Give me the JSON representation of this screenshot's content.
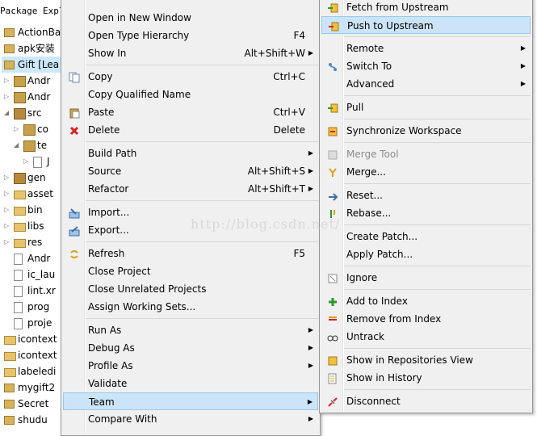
{
  "explorer": {
    "title": "Package Expl",
    "items": [
      {
        "label": "ActionBa",
        "indent": 0,
        "icon": "project-icon",
        "twisty": ""
      },
      {
        "label": "apk安装",
        "indent": 0,
        "icon": "project-icon",
        "twisty": ""
      },
      {
        "label": "Gift [Lea",
        "indent": 0,
        "icon": "project-icon",
        "twisty": "",
        "selected": true
      },
      {
        "label": "Andr",
        "indent": 1,
        "icon": "library-icon",
        "twisty": "▷"
      },
      {
        "label": "Andr",
        "indent": 1,
        "icon": "library-icon",
        "twisty": "▷"
      },
      {
        "label": "src",
        "indent": 1,
        "icon": "source-folder-icon",
        "twisty": "◢"
      },
      {
        "label": "co",
        "indent": 2,
        "icon": "package-icon",
        "twisty": "▷"
      },
      {
        "label": "te",
        "indent": 2,
        "icon": "package-icon",
        "twisty": "◢"
      },
      {
        "label": "J",
        "indent": 3,
        "icon": "java-file-icon",
        "twisty": "▷"
      },
      {
        "label": "gen",
        "indent": 1,
        "icon": "source-folder-icon",
        "twisty": "▷"
      },
      {
        "label": "asset",
        "indent": 1,
        "icon": "folder-icon",
        "twisty": "▷"
      },
      {
        "label": "bin",
        "indent": 1,
        "icon": "folder-icon",
        "twisty": "▷"
      },
      {
        "label": "libs",
        "indent": 1,
        "icon": "folder-icon",
        "twisty": "▷"
      },
      {
        "label": "res",
        "indent": 1,
        "icon": "folder-icon",
        "twisty": "▷"
      },
      {
        "label": "Andr",
        "indent": 1,
        "icon": "file-icon",
        "twisty": ""
      },
      {
        "label": "ic_lau",
        "indent": 1,
        "icon": "file-icon",
        "twisty": ""
      },
      {
        "label": "lint.xr",
        "indent": 1,
        "icon": "file-icon",
        "twisty": ""
      },
      {
        "label": "prog",
        "indent": 1,
        "icon": "file-icon",
        "twisty": ""
      },
      {
        "label": "proje",
        "indent": 1,
        "icon": "file-icon",
        "twisty": ""
      },
      {
        "label": "icontext",
        "indent": 0,
        "icon": "closed-project-icon",
        "twisty": ""
      },
      {
        "label": "icontext",
        "indent": 0,
        "icon": "closed-project-icon",
        "twisty": ""
      },
      {
        "label": "labeledi",
        "indent": 0,
        "icon": "closed-project-icon",
        "twisty": ""
      },
      {
        "label": "mygift2",
        "indent": 0,
        "icon": "project-icon",
        "twisty": ""
      },
      {
        "label": "Secret",
        "indent": 0,
        "icon": "project-icon",
        "twisty": ""
      },
      {
        "label": "shudu",
        "indent": 0,
        "icon": "project-icon",
        "twisty": ""
      }
    ]
  },
  "context_menu": {
    "items": [
      {
        "label": "Open in New Window",
        "shortcut": "",
        "arrow": false,
        "icon": ""
      },
      {
        "label": "Open Type Hierarchy",
        "shortcut": "F4",
        "arrow": false,
        "icon": ""
      },
      {
        "label": "Show In",
        "shortcut": "Alt+Shift+W",
        "arrow": true,
        "icon": ""
      },
      {
        "sep": true
      },
      {
        "label": "Copy",
        "shortcut": "Ctrl+C",
        "arrow": false,
        "icon": "copy-icon"
      },
      {
        "label": "Copy Qualified Name",
        "shortcut": "",
        "arrow": false,
        "icon": ""
      },
      {
        "label": "Paste",
        "shortcut": "Ctrl+V",
        "arrow": false,
        "icon": "paste-icon"
      },
      {
        "label": "Delete",
        "shortcut": "Delete",
        "arrow": false,
        "icon": "delete-icon"
      },
      {
        "sep": true
      },
      {
        "label": "Build Path",
        "shortcut": "",
        "arrow": true,
        "icon": ""
      },
      {
        "label": "Source",
        "shortcut": "Alt+Shift+S",
        "arrow": true,
        "icon": ""
      },
      {
        "label": "Refactor",
        "shortcut": "Alt+Shift+T",
        "arrow": true,
        "icon": ""
      },
      {
        "sep": true
      },
      {
        "label": "Import...",
        "shortcut": "",
        "arrow": false,
        "icon": "import-icon"
      },
      {
        "label": "Export...",
        "shortcut": "",
        "arrow": false,
        "icon": "export-icon"
      },
      {
        "sep": true
      },
      {
        "label": "Refresh",
        "shortcut": "F5",
        "arrow": false,
        "icon": "refresh-icon"
      },
      {
        "label": "Close Project",
        "shortcut": "",
        "arrow": false,
        "icon": ""
      },
      {
        "label": "Close Unrelated Projects",
        "shortcut": "",
        "arrow": false,
        "icon": ""
      },
      {
        "label": "Assign Working Sets...",
        "shortcut": "",
        "arrow": false,
        "icon": ""
      },
      {
        "sep": true
      },
      {
        "label": "Run As",
        "shortcut": "",
        "arrow": true,
        "icon": ""
      },
      {
        "label": "Debug As",
        "shortcut": "",
        "arrow": true,
        "icon": ""
      },
      {
        "label": "Profile As",
        "shortcut": "",
        "arrow": true,
        "icon": ""
      },
      {
        "label": "Validate",
        "shortcut": "",
        "arrow": false,
        "icon": ""
      },
      {
        "label": "Team",
        "shortcut": "",
        "arrow": true,
        "icon": "",
        "highlighted": true
      },
      {
        "label": "Compare With",
        "shortcut": "",
        "arrow": true,
        "icon": ""
      }
    ]
  },
  "team_submenu": {
    "items": [
      {
        "label": "Fetch from Upstream",
        "arrow": false,
        "icon": "fetch-icon"
      },
      {
        "label": "Push to Upstream",
        "arrow": false,
        "icon": "push-icon",
        "highlighted": true
      },
      {
        "sep": true
      },
      {
        "label": "Remote",
        "arrow": true,
        "icon": ""
      },
      {
        "label": "Switch To",
        "arrow": true,
        "icon": "switch-branch-icon"
      },
      {
        "label": "Advanced",
        "arrow": true,
        "icon": ""
      },
      {
        "sep": true
      },
      {
        "label": "Pull",
        "arrow": false,
        "icon": "pull-icon"
      },
      {
        "sep": true
      },
      {
        "label": "Synchronize Workspace",
        "arrow": false,
        "icon": "synchronize-icon"
      },
      {
        "sep": true
      },
      {
        "label": "Merge Tool",
        "arrow": false,
        "icon": "merge-tool-icon",
        "disabled": true
      },
      {
        "label": "Merge...",
        "arrow": false,
        "icon": "merge-icon"
      },
      {
        "sep": true
      },
      {
        "label": "Reset...",
        "arrow": false,
        "icon": "reset-icon"
      },
      {
        "label": "Rebase...",
        "arrow": false,
        "icon": "rebase-icon"
      },
      {
        "sep": true
      },
      {
        "label": "Create Patch...",
        "arrow": false,
        "icon": ""
      },
      {
        "label": "Apply Patch...",
        "arrow": false,
        "icon": ""
      },
      {
        "sep": true
      },
      {
        "label": "Ignore",
        "arrow": false,
        "icon": "ignore-icon"
      },
      {
        "sep": true
      },
      {
        "label": "Add to Index",
        "arrow": false,
        "icon": "add-index-icon"
      },
      {
        "label": "Remove from Index",
        "arrow": false,
        "icon": "remove-index-icon"
      },
      {
        "label": "Untrack",
        "arrow": false,
        "icon": "untrack-icon"
      },
      {
        "sep": true
      },
      {
        "label": "Show in Repositories View",
        "arrow": false,
        "icon": "repositories-icon"
      },
      {
        "label": "Show in History",
        "arrow": false,
        "icon": "history-icon"
      },
      {
        "sep": true
      },
      {
        "label": "Disconnect",
        "arrow": false,
        "icon": "disconnect-icon"
      }
    ]
  },
  "watermark": "http://blog.csdn.net/",
  "arrow_glyph": "▶",
  "colors": {
    "highlight": "#cce4f7",
    "menu_bg": "#f0f0f0",
    "selection": "#cce8ff"
  }
}
